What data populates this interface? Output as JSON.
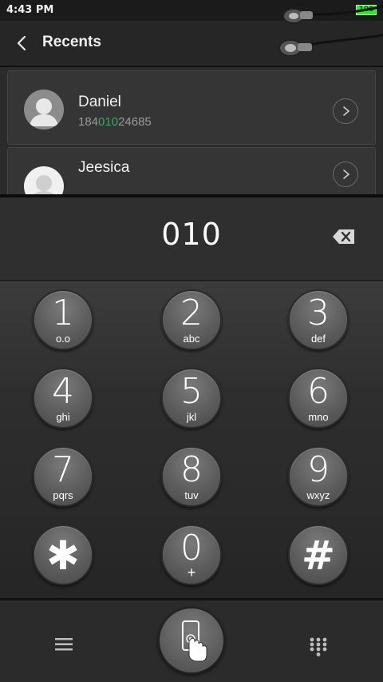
{
  "status_bar": {
    "time": "4:43 PM",
    "battery": "100"
  },
  "header": {
    "title": "Recents",
    "back_icon": "back-arrow-icon"
  },
  "recents": [
    {
      "name": "Daniel",
      "number_pre": "184",
      "number_match": "010",
      "number_post": "24685"
    },
    {
      "name": "Jeesica"
    }
  ],
  "dialer": {
    "dialed_number": "010",
    "backspace_icon": "backspace-icon"
  },
  "keypad": [
    {
      "digit": "1",
      "letters": "o.o"
    },
    {
      "digit": "2",
      "letters": "abc"
    },
    {
      "digit": "3",
      "letters": "def"
    },
    {
      "digit": "4",
      "letters": "ghi"
    },
    {
      "digit": "5",
      "letters": "jkl"
    },
    {
      "digit": "6",
      "letters": "mno"
    },
    {
      "digit": "7",
      "letters": "pqrs"
    },
    {
      "digit": "8",
      "letters": "tuv"
    },
    {
      "digit": "9",
      "letters": "wxyz"
    },
    {
      "digit": "✱",
      "letters": ""
    },
    {
      "digit": "0",
      "letters": "+"
    },
    {
      "digit": "#",
      "letters": ""
    }
  ],
  "bottom_bar": {
    "menu_icon": "menu-icon",
    "call_icon": "phone-touch-icon",
    "dialpad_icon": "dialpad-icon"
  },
  "colors": {
    "match_highlight": "#2fae5f",
    "battery": "#2ee82e"
  }
}
